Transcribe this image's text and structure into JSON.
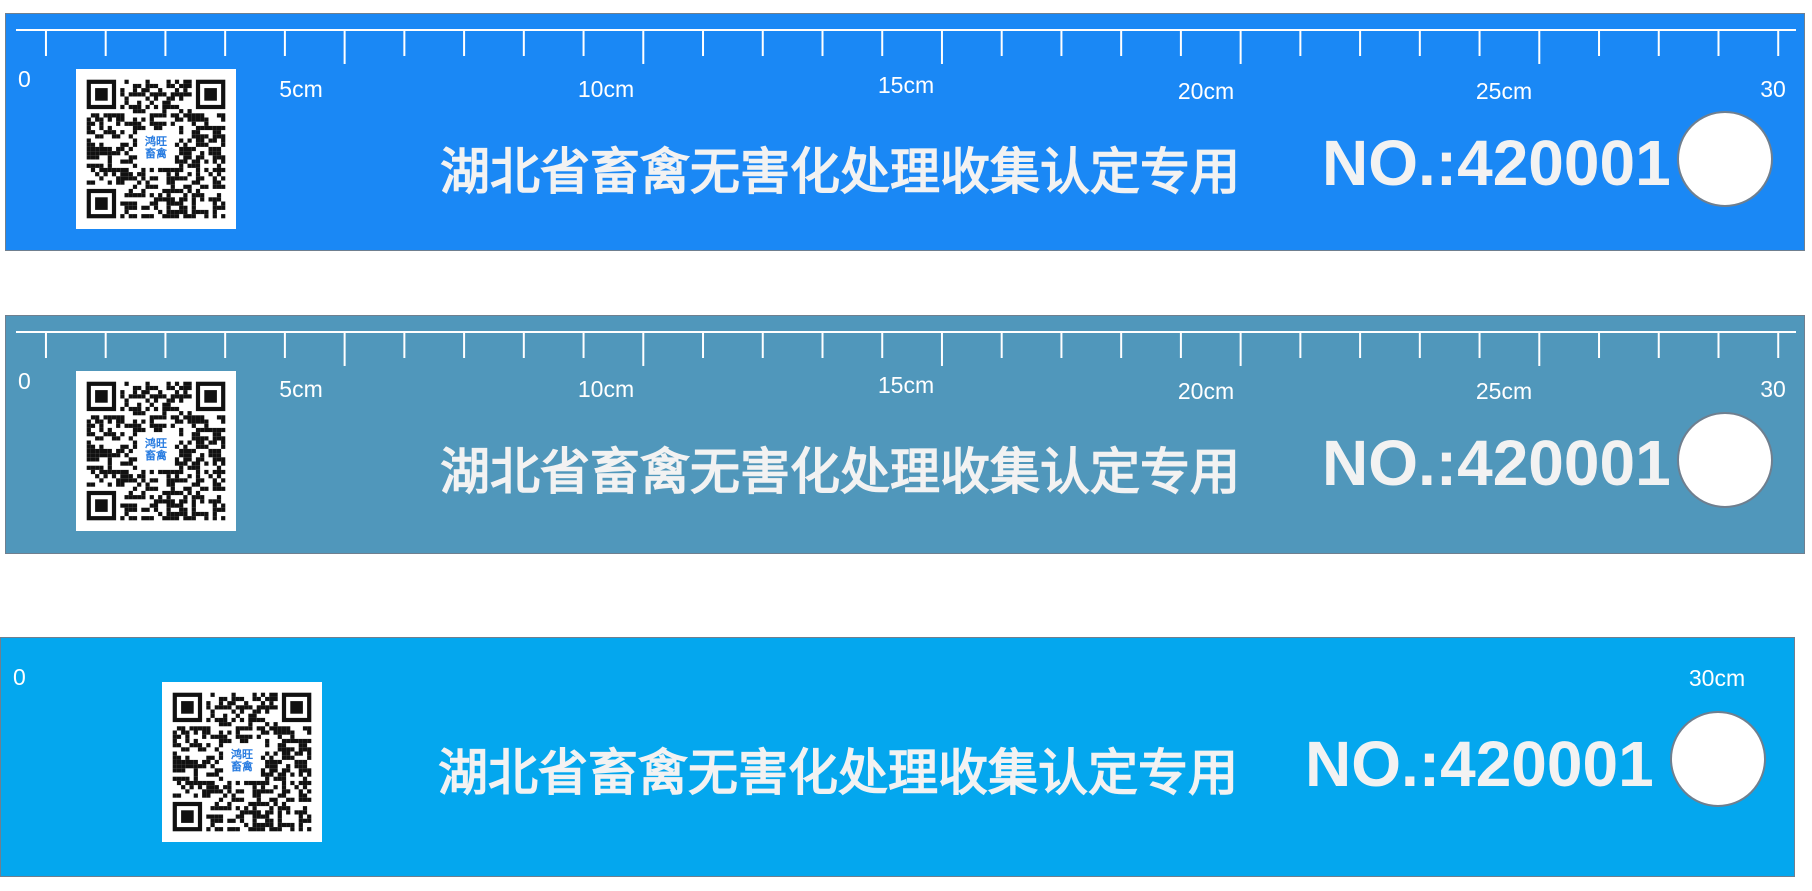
{
  "tags": [
    {
      "color": "#1a88f5",
      "ruler": true,
      "zero_label": "0",
      "cm_labels": [
        "5cm",
        "10cm",
        "15cm",
        "20cm",
        "25cm",
        "30"
      ],
      "qr_badge_text": "鸿旺 畜禽",
      "title": "湖北省畜禽无害化处理收集认定专用",
      "serial": "NO.:420001"
    },
    {
      "color": "#5097bb",
      "ruler": true,
      "zero_label": "0",
      "cm_labels": [
        "5cm",
        "10cm",
        "15cm",
        "20cm",
        "25cm",
        "30"
      ],
      "qr_badge_text": "鸿旺 畜禽",
      "title": "湖北省畜禽无害化处理收集认定专用",
      "serial": "NO.:420001"
    },
    {
      "color": "#04a7ee",
      "ruler": false,
      "zero_label": "0",
      "end_label": "30cm",
      "qr_badge_text": "鸿旺 畜禽",
      "title": "湖北省畜禽无害化处理收集认定专用",
      "serial": "NO.:420001"
    }
  ]
}
